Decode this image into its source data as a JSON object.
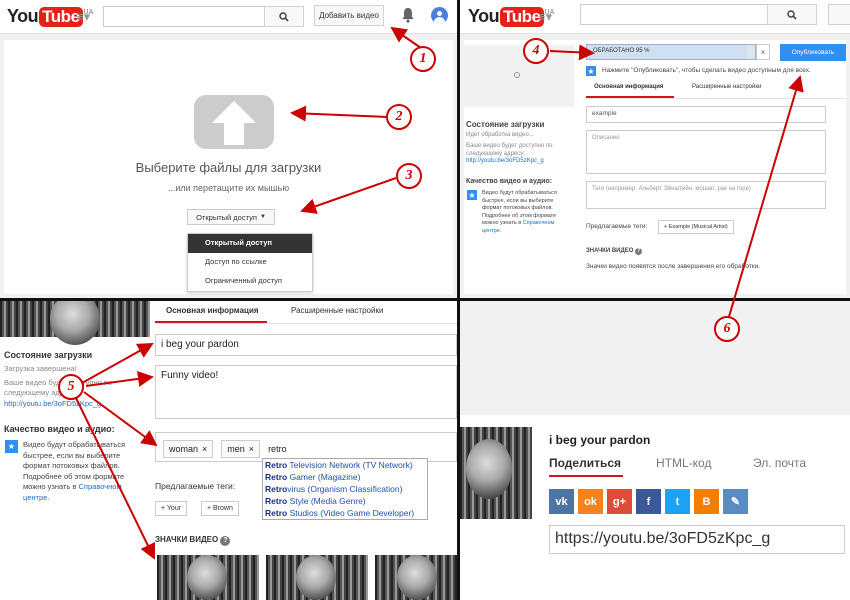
{
  "brand": {
    "logo_you": "You",
    "logo_tube": "Tube",
    "logo_region": "UA"
  },
  "colors": {
    "accent_red": "#e62117",
    "callout_red": "#cc0000",
    "publish_blue": "#2f8ff2",
    "link_blue": "#1a6fc2"
  },
  "icons": {
    "search": "search-icon",
    "bell": "bell-icon",
    "guide": "guide-menu-icon",
    "upload": "upload-arrow-icon",
    "star": "star-icon"
  },
  "panel1": {
    "upload_button": "Добавить видео",
    "title": "Выберите файлы для загрузки",
    "subtitle": "...или перетащите их мышью",
    "privacy_button": "Открытый доступ",
    "privacy_options": [
      "Открытый доступ",
      "Доступ по ссылке",
      "Ограниченный доступ"
    ]
  },
  "panel2": {
    "progress_text": "ОБРАБОТАНО 95 %",
    "progress_value": 0.95,
    "close_symbol": "×",
    "publish_button": "Опубликовать",
    "publish_hint": "Нажмите \"Опубликовать\", чтобы сделать видео доступным для всех.",
    "tab_basic": "Основная информация",
    "tab_advanced": "Расширенные настройки",
    "title_value": "example",
    "description_placeholder": "Описание",
    "tags_placeholder": "Теги (например: Альберт Эйнштейн, мошап, рак на горе)",
    "suggested_label": "Предлагаемые теги:",
    "suggested_chip": "+ Example (Musical Artist)",
    "badges_title": "ЗНАЧКИ ВИДЕО",
    "badges_text": "Значки видео появятся после завершения его обработки.",
    "status_title": "Состояние загрузки",
    "status_text": "Идет обработка видео...",
    "url_hint": "Ваше видео будет доступно по следующему адресу:",
    "url": "http://youtu.be/3oFD5zKpc_g",
    "quality_title": "Качество видео и аудио:",
    "quality_text": "Видео будут обрабатываться быстрее, если вы выберите формат потоковых файлов. Подробнее об этом формате можно узнать в",
    "quality_link": "Справочном центре."
  },
  "panel3": {
    "status_title": "Состояние загрузки",
    "status_done": "Загрузка завершена!",
    "url_hint": "Ваше видео будет доступно по следующему адресу:",
    "url": "http://youtu.be/3oFD5zKpc_g",
    "tab_basic": "Основная информация",
    "tab_advanced": "Расширенные настройки",
    "title_value": "i beg your pardon",
    "description_value": "Funny video!",
    "tags": [
      "woman",
      "men"
    ],
    "tag_input_value": "retro",
    "autocomplete": [
      {
        "bold": "Retro",
        "rest": " Television Network (TV Network)"
      },
      {
        "bold": "Retro",
        "rest": " Gamer (Magazine)"
      },
      {
        "bold": "Retro",
        "rest": "virus (Organism Classification)"
      },
      {
        "bold": "Retro",
        "rest": " Style (Media Genre)"
      },
      {
        "bold": "Retro",
        "rest": " Studios (Video Game Developer)"
      }
    ],
    "suggested_label": "Предлагаемые теги:",
    "suggested_chips": [
      "+ Your",
      "+ Brown"
    ],
    "quality_title": "Качество видео и аудио:",
    "quality_text": "Видео будут обрабатываться быстрее, если вы выберите формат потоковых файлов. Подробнее об этом формате можно узнать в",
    "quality_link": "Справочном центре.",
    "badges_title": "ЗНАЧКИ ВИДЕО"
  },
  "panel4": {
    "video_title": "i beg your pardon",
    "tabs": [
      "Поделиться",
      "HTML-код",
      "Эл. почта"
    ],
    "social": [
      {
        "name": "vk-icon",
        "glyph": "vk",
        "color": "#4c75a3"
      },
      {
        "name": "odnoklassniki-icon",
        "glyph": "ok",
        "color": "#f58220"
      },
      {
        "name": "google-plus-icon",
        "glyph": "g+",
        "color": "#dd4b39"
      },
      {
        "name": "facebook-icon",
        "glyph": "f",
        "color": "#3b5998"
      },
      {
        "name": "twitter-icon",
        "glyph": "t",
        "color": "#1da1f2"
      },
      {
        "name": "blogger-icon",
        "glyph": "B",
        "color": "#f57d00"
      },
      {
        "name": "livejournal-icon",
        "glyph": "✎",
        "color": "#5b8bc4"
      }
    ],
    "share_url": "https://youtu.be/3oFD5zKpc_g"
  },
  "callouts": [
    "1",
    "2",
    "3",
    "4",
    "5",
    "6"
  ]
}
